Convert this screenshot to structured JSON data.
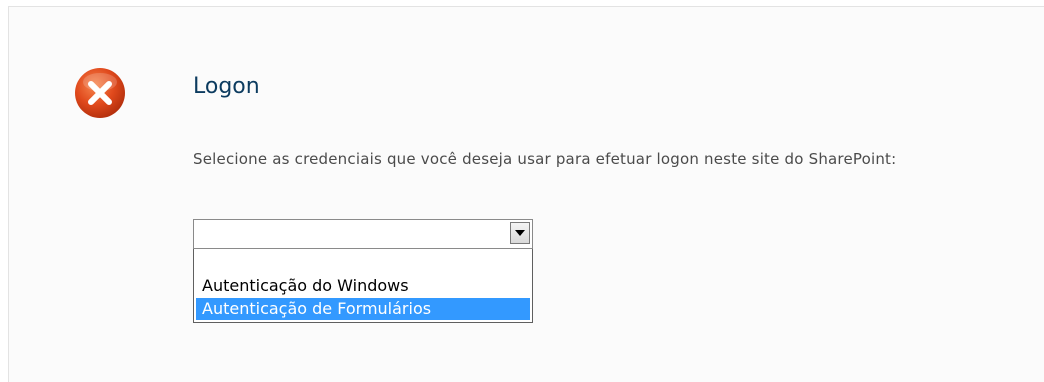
{
  "dialog": {
    "title": "Logon",
    "instruction": "Selecione as credenciais que você deseja usar para efetuar logon neste site do SharePoint:",
    "icon": "error-icon",
    "colors": {
      "title": "#0c3b5f",
      "icon": "#e0491c",
      "selected_option_bg": "#3399ff"
    }
  },
  "credential_select": {
    "value": "",
    "options": [
      "",
      "Autenticação do Windows",
      "Autenticação de Formulários"
    ],
    "highlighted_option": "Autenticação de Formulários"
  }
}
